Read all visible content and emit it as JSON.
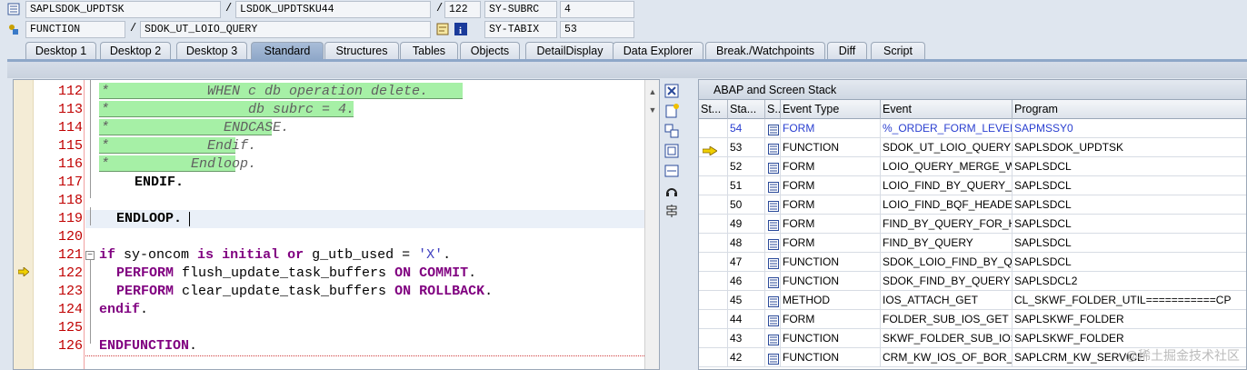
{
  "header": {
    "row1": {
      "program": "SAPLSDOK_UPDTSK",
      "include": "LSDOK_UPDTSKU44",
      "line": "122",
      "sysvar": "SY-SUBRC",
      "sysval": "4"
    },
    "row2": {
      "type": "FUNCTION",
      "name": "SDOK_UT_LOIO_QUERY",
      "sysvar": "SY-TABIX",
      "sysval": "53"
    },
    "sep": "/"
  },
  "tabs": [
    {
      "label": "Desktop 1"
    },
    {
      "label": "Desktop 2"
    },
    {
      "label": "Desktop 3"
    },
    {
      "label": "Standard",
      "active": true
    },
    {
      "label": "Structures"
    },
    {
      "label": "Tables"
    },
    {
      "label": "Objects"
    },
    {
      "label": "DetailDisplay"
    },
    {
      "label": "Data Explorer"
    },
    {
      "label": "Break./Watchpoints"
    },
    {
      "label": "Diff"
    },
    {
      "label": "Script"
    }
  ],
  "editor": {
    "lines": [
      {
        "num": "112",
        "type": "comment",
        "text": "*            WHEN c db operation delete."
      },
      {
        "num": "113",
        "type": "comment",
        "text": "*                 db subrc = 4."
      },
      {
        "num": "114",
        "type": "comment",
        "text": "*              ENDCASE."
      },
      {
        "num": "115",
        "type": "comment",
        "text": "*            Endif."
      },
      {
        "num": "116",
        "type": "comment",
        "text": "*          Endloop."
      },
      {
        "num": "117",
        "type": "code",
        "text": "ENDIF."
      },
      {
        "num": "118",
        "type": "blank",
        "text": ""
      },
      {
        "num": "119",
        "type": "code",
        "text": "ENDLOOP."
      },
      {
        "num": "120",
        "type": "blank",
        "text": ""
      },
      {
        "num": "121",
        "type": "code",
        "text": "if sy-oncom is initial or g_utb_used = 'X'."
      },
      {
        "num": "122",
        "type": "code",
        "text": "PERFORM flush_update_task_buffers ON COMMIT."
      },
      {
        "num": "123",
        "type": "code",
        "text": "PERFORM clear_update_task_buffers ON ROLLBACK."
      },
      {
        "num": "124",
        "type": "code",
        "text": "endif."
      },
      {
        "num": "125",
        "type": "blank",
        "text": ""
      },
      {
        "num": "126",
        "type": "code",
        "text": "ENDFUNCTION."
      }
    ],
    "current_line": "122"
  },
  "stack": {
    "title": "ABAP and Screen Stack",
    "columns": [
      "St...",
      "Sta...",
      "S...",
      "Event Type",
      "Event",
      "Program"
    ],
    "rows": [
      {
        "level": "54",
        "type": "FORM",
        "event": "%_ORDER_FORM_LEVEL",
        "program": "SAPMSSY0",
        "blue": true
      },
      {
        "level": "53",
        "type": "FUNCTION",
        "event": "SDOK_UT_LOIO_QUERY",
        "program": "SAPLSDOK_UPDTSK",
        "current": true
      },
      {
        "level": "52",
        "type": "FORM",
        "event": "LOIO_QUERY_MERGE_W...",
        "program": "SAPLSDCL"
      },
      {
        "level": "51",
        "type": "FORM",
        "event": "LOIO_FIND_BY_QUERY_...",
        "program": "SAPLSDCL"
      },
      {
        "level": "50",
        "type": "FORM",
        "event": "LOIO_FIND_BQF_HEADE...",
        "program": "SAPLSDCL"
      },
      {
        "level": "49",
        "type": "FORM",
        "event": "FIND_BY_QUERY_FOR_H...",
        "program": "SAPLSDCL"
      },
      {
        "level": "48",
        "type": "FORM",
        "event": "FIND_BY_QUERY",
        "program": "SAPLSDCL"
      },
      {
        "level": "47",
        "type": "FUNCTION",
        "event": "SDOK_LOIO_FIND_BY_Q...",
        "program": "SAPLSDCL"
      },
      {
        "level": "46",
        "type": "FUNCTION",
        "event": "SDOK_FIND_BY_QUERY",
        "program": "SAPLSDCL2"
      },
      {
        "level": "45",
        "type": "METHOD",
        "event": "IOS_ATTACH_GET",
        "program": "CL_SKWF_FOLDER_UTIL===========CP"
      },
      {
        "level": "44",
        "type": "FORM",
        "event": "FOLDER_SUB_IOS_GET",
        "program": "SAPLSKWF_FOLDER"
      },
      {
        "level": "43",
        "type": "FUNCTION",
        "event": "SKWF_FOLDER_SUB_IOS...",
        "program": "SAPLSKWF_FOLDER"
      },
      {
        "level": "42",
        "type": "FUNCTION",
        "event": "CRM_KW_IOS_OF_BOR_...",
        "program": "SAPLCRM_KW_SERVICE"
      }
    ]
  },
  "watermark": "@稀土掘金技术社区",
  "colors": {
    "comment_bg": "#a6f0a6",
    "keyword": "#800080",
    "line_number": "#c00000",
    "active_tab": "#8ea7c8"
  }
}
